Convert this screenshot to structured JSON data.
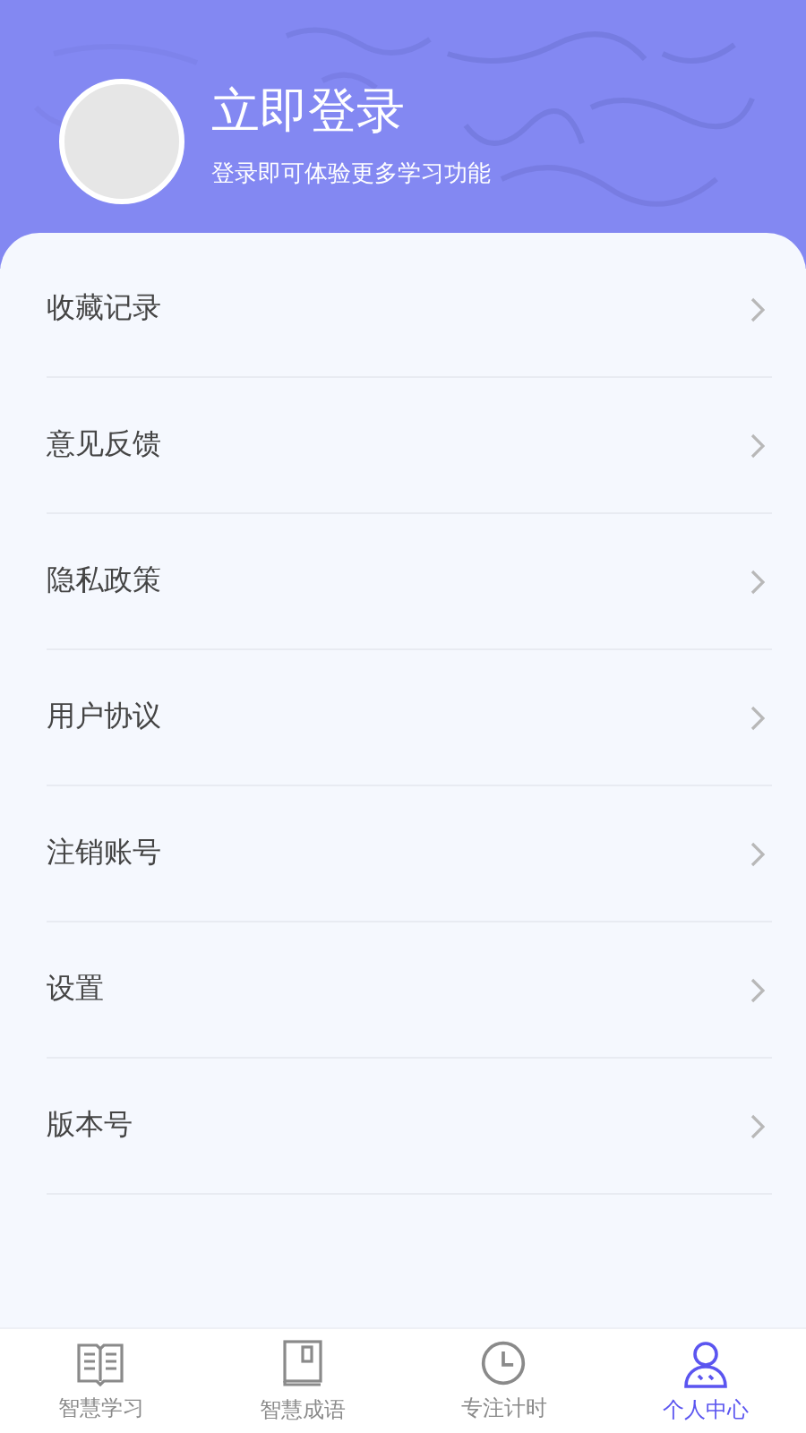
{
  "header": {
    "title": "立即登录",
    "subtitle": "登录即可体验更多学习功能"
  },
  "menu": [
    {
      "label": "收藏记录"
    },
    {
      "label": "意见反馈"
    },
    {
      "label": "隐私政策"
    },
    {
      "label": "用户协议"
    },
    {
      "label": "注销账号"
    },
    {
      "label": "设置"
    },
    {
      "label": "版本号"
    }
  ],
  "tabs": [
    {
      "label": "智慧学习",
      "selected": false
    },
    {
      "label": "智慧成语",
      "selected": false
    },
    {
      "label": "专注计时",
      "selected": false
    },
    {
      "label": "个人中心",
      "selected": true
    }
  ]
}
